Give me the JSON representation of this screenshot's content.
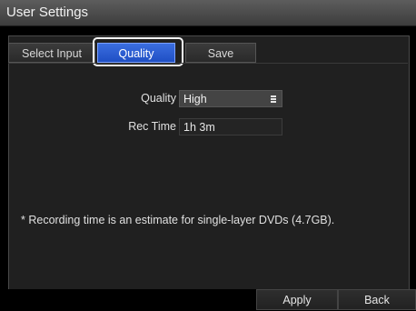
{
  "window": {
    "title": "User Settings"
  },
  "tabs": [
    {
      "label": "Select Input",
      "active": false
    },
    {
      "label": "Quality",
      "active": true
    },
    {
      "label": "Save",
      "active": false
    }
  ],
  "quality": {
    "label": "Quality",
    "value": "High",
    "icon": "list-icon"
  },
  "rec_time": {
    "label": "Rec Time",
    "value": "1h 3m"
  },
  "note": "* Recording time is an estimate for single-layer DVDs (4.7GB).",
  "buttons": {
    "apply": "Apply",
    "back": "Back"
  },
  "colors": {
    "active_tab": "#1f4fc4",
    "background": "#202020"
  }
}
